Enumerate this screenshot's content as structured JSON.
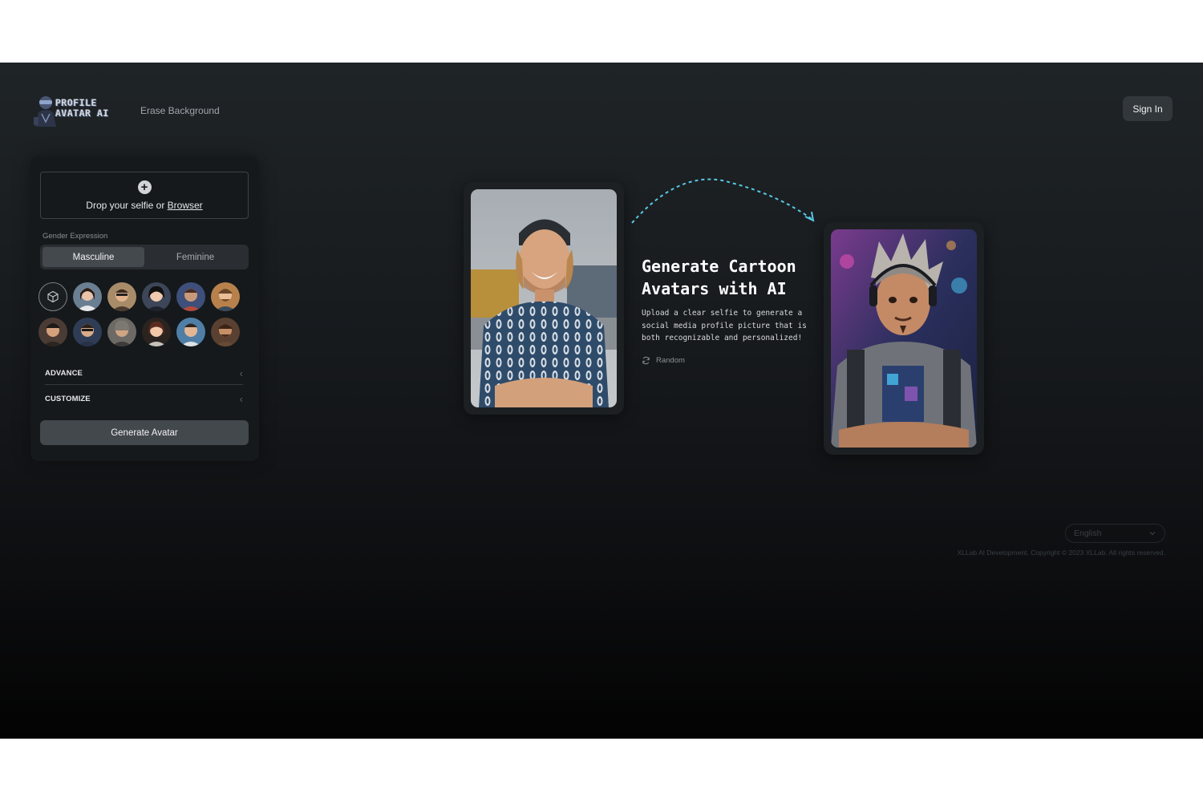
{
  "header": {
    "logo_line1": "PROFILE",
    "logo_line2": "AVATAR AI",
    "nav_erase": "Erase Background",
    "sign_in": "Sign In"
  },
  "panel": {
    "drop_text": "Drop your selfie or ",
    "drop_link": "Browser",
    "gender_label": "Gender Expression",
    "gender_options": [
      "Masculine",
      "Feminine"
    ],
    "gender_selected": "Masculine",
    "advance_label": "ADVANCE",
    "customize_label": "CUSTOMIZE",
    "generate_button": "Generate Avatar"
  },
  "hero": {
    "title": "Generate Cartoon Avatars with AI",
    "description": "Upload a clear selfie to generate a social media profile picture that is both recognizable and personalized!",
    "random_label": "Random"
  },
  "footer": {
    "language": "English",
    "copyright": "XLLab AI Development. Copyright © 2023 XLLab. All rights reserved."
  },
  "colors": {
    "accent_arrow": "#58c8e4",
    "panel_bg": "#15191c",
    "button_bg": "#43484d"
  },
  "icons": [
    "plus-icon",
    "cube-icon",
    "refresh-icon",
    "chevron-left-icon",
    "chevron-down-icon"
  ]
}
